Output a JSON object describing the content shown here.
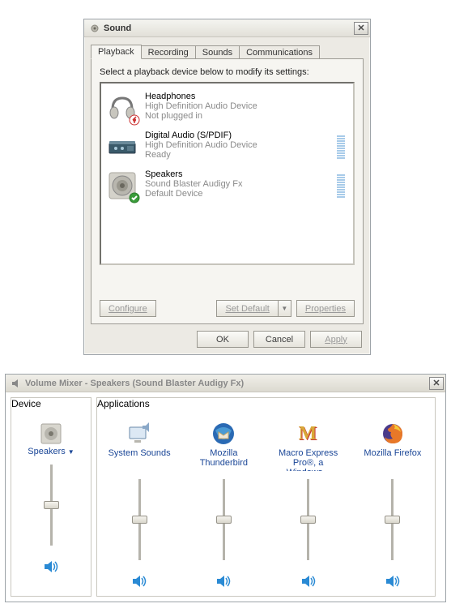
{
  "sound": {
    "window_title": "Sound",
    "tabs": [
      "Playback",
      "Recording",
      "Sounds",
      "Communications"
    ],
    "active_tab": 0,
    "instruction": "Select a playback device below to modify its settings:",
    "devices": [
      {
        "name": "Headphones",
        "sub": "High Definition Audio Device",
        "status": "Not plugged in",
        "icon": "headphones",
        "badge": "unplugged",
        "has_meter": false
      },
      {
        "name": "Digital Audio (S/PDIF)",
        "sub": "High Definition Audio Device",
        "status": "Ready",
        "icon": "spdif",
        "badge": null,
        "has_meter": true
      },
      {
        "name": "Speakers",
        "sub": "Sound Blaster Audigy Fx",
        "status": "Default Device",
        "icon": "speaker-cone",
        "badge": "check",
        "has_meter": true
      }
    ],
    "buttons": {
      "configure": "Configure",
      "set_default": "Set Default",
      "properties": "Properties",
      "ok": "OK",
      "cancel": "Cancel",
      "apply": "Apply"
    }
  },
  "mixer": {
    "window_title": "Volume Mixer - Speakers (Sound Blaster Audigy Fx)",
    "device_group": "Device",
    "apps_group": "Applications",
    "device": {
      "label": "Speakers",
      "icon": "speaker-gray",
      "level": 50
    },
    "apps": [
      {
        "label": "System Sounds",
        "icon": "system-sounds",
        "level": 50
      },
      {
        "label": "Mozilla Thunderbird",
        "icon": "thunderbird",
        "level": 50
      },
      {
        "label": "Macro Express Pro®, a Windows...",
        "icon": "macro-express",
        "level": 50
      },
      {
        "label": "Mozilla Firefox",
        "icon": "firefox",
        "level": 50
      }
    ]
  }
}
